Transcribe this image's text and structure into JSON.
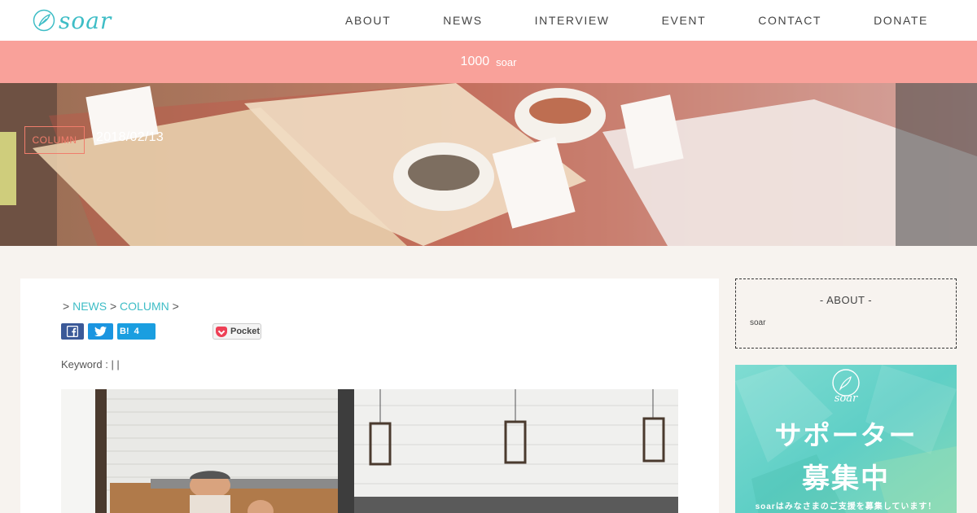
{
  "brand": {
    "name": "soar",
    "color": "#3ebdc6"
  },
  "nav": [
    {
      "label": "ABOUT"
    },
    {
      "label": "NEWS"
    },
    {
      "label": "INTERVIEW"
    },
    {
      "label": "EVENT"
    },
    {
      "label": "CONTACT"
    },
    {
      "label": "DONATE"
    }
  ],
  "banner": {
    "number": "1000",
    "text": "soar",
    "color": "#f9a19a"
  },
  "hero": {
    "category": "COLUMN",
    "date": "2018/02/13"
  },
  "breadcrumb": {
    "sep": ">",
    "items": [
      "NEWS",
      "COLUMN"
    ]
  },
  "share": {
    "hatena_label": "B!",
    "hatena_count": "4",
    "pocket_label": "Pocket"
  },
  "keyword": {
    "label": "Keyword :",
    "value": "| |"
  },
  "sidebar": {
    "about_title": "- ABOUT -",
    "about_text": "soar",
    "supporter_logo": "soar",
    "supporter_line1": "サポーター",
    "supporter_line2": "募集中",
    "supporter_caption": "soarはみなさまのご支援を募集しています！"
  }
}
